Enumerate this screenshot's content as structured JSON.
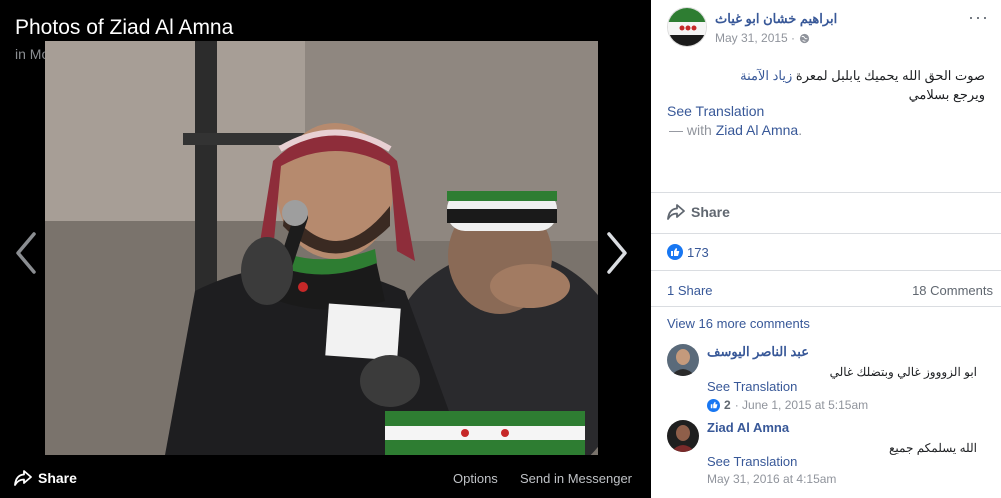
{
  "viewer": {
    "title": "Photos of Ziad Al Amna",
    "subtitle": "in Mobile Uploads",
    "share_label": "Share",
    "options_label": "Options",
    "messenger_label": "Send in Messenger"
  },
  "post": {
    "author": "ابراهيم خشان ابو غياث",
    "date": "May 31, 2015 ·",
    "body_line1_prefix": "صوت الحق الله يحميك يابلبل لمعرة",
    "body_tag": "زياد الآمنة",
    "body_line2": "ويرجع بسلامي",
    "see_translation": "See Translation",
    "with_prefix": "— with",
    "with_name": "Ziad Al Amna",
    "with_suffix": ".",
    "more": "···",
    "share_label": "Share"
  },
  "stats": {
    "likes": "173",
    "shares": "1 Share",
    "comments": "18 Comments",
    "view_more": "View 16 more comments"
  },
  "comments": [
    {
      "name": "عبد الناصر اليوسف",
      "text": "ابو الزوووز غالي وبتضلك غالي",
      "translate": "See Translation",
      "reactions": "2",
      "meta": "· June 1, 2015 at 5:15am"
    },
    {
      "name": "Ziad Al Amna",
      "text": "الله يسلمكم جميع",
      "translate": "See Translation",
      "meta": "May 31, 2016 at 4:15am"
    }
  ],
  "colors": {
    "link": "#385898",
    "like": "#1877f2",
    "muted": "#90949c"
  }
}
